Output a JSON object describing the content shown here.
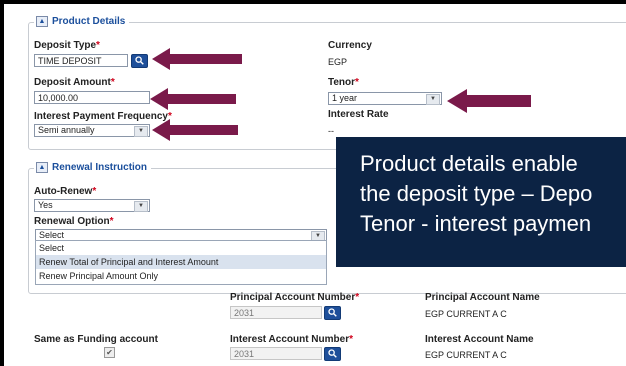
{
  "product_details": {
    "section_title": "Product Details",
    "deposit_type": {
      "label": "Deposit Type",
      "required_mark": "*",
      "value": "TIME DEPOSIT"
    },
    "currency": {
      "label": "Currency",
      "value": "EGP"
    },
    "deposit_amount": {
      "label": "Deposit Amount",
      "required_mark": "*",
      "value": "10,000.00"
    },
    "tenor": {
      "label": "Tenor",
      "required_mark": "*",
      "value": "1 year"
    },
    "interest_payment_frequency": {
      "label": "Interest Payment Frequency",
      "required_mark": "*",
      "value": "Semi annually"
    },
    "interest_rate": {
      "label": "Interest Rate",
      "value": "--"
    }
  },
  "renewal_instruction": {
    "section_title": "Renewal Instruction",
    "auto_renew": {
      "label": "Auto-Renew",
      "required_mark": "*",
      "value": "Yes"
    },
    "renewal_option": {
      "label": "Renewal Option",
      "required_mark": "*",
      "value": "Select",
      "options": [
        "Select",
        "Renew Total of Principal and Interest Amount",
        "Renew Principal Amount Only"
      ]
    }
  },
  "principal_account": {
    "number_label": "Principal Account Number",
    "required_mark": "*",
    "number_value": "2031",
    "name_label": "Principal Account Name",
    "name_value": "EGP CURRENT A C"
  },
  "funding": {
    "same_as_funding_label": "Same as Funding account",
    "checked": true
  },
  "interest_account": {
    "number_label": "Interest Account Number",
    "required_mark": "*",
    "number_value": "2031",
    "name_label": "Interest Account Name",
    "name_value": "EGP CURRENT A C"
  },
  "overlay": {
    "line1": "Product details enable",
    "line2": "the deposit type – Depo",
    "line3": "Tenor - interest paymen"
  },
  "colors": {
    "annotation_arrow": "#7a1a4a",
    "overlay_bg": "#0c2344",
    "accent": "#1b4f9c"
  }
}
